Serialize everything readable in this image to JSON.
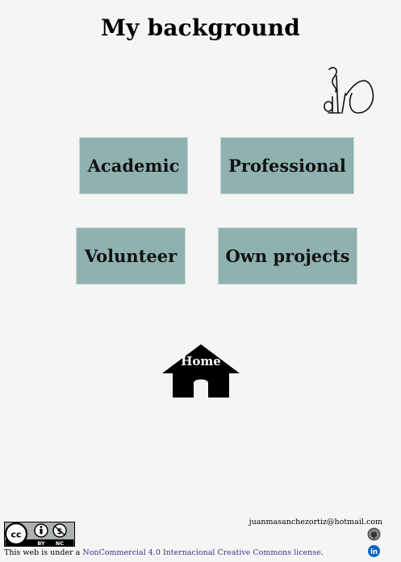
{
  "page": {
    "title": "My background"
  },
  "cards": {
    "academic": "Academic",
    "professional": "Professional",
    "volunteer": "Volunteer",
    "own_projects": "Own projects"
  },
  "home": {
    "label": "Home"
  },
  "footer": {
    "license_prefix": "This web is under a ",
    "license_link": "NonCommercial 4.0 Internacional Creative Commons license",
    "license_suffix": ".",
    "cc_badge_text": {
      "by": "BY",
      "nc": "NC"
    },
    "email": "juanmasanchezortiz@hotmail.com"
  },
  "colors": {
    "card": "#8fb1b0",
    "background": "#f5f5f5",
    "link": "#4b2b8a",
    "linkedin": "#0a66c2"
  }
}
